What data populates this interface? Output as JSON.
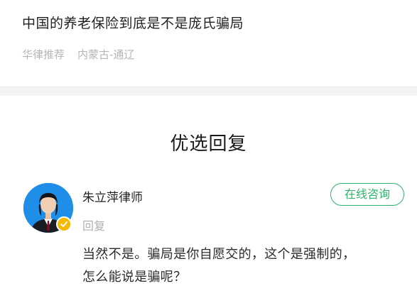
{
  "question": {
    "title": "中国的养老保险到底是不是庞氏骗局",
    "source": "华律推荐",
    "location": "内蒙古-通辽"
  },
  "section": {
    "title": "优选回复"
  },
  "reply": {
    "lawyer_name": "朱立萍律师",
    "reply_label": "回复",
    "consult_button": "在线咨询",
    "answer_line1": "当然不是。骗局是你自愿交的，这个是强制的，",
    "answer_line2": "怎么能说是骗呢？"
  },
  "colors": {
    "accent_green": "#2fb36b",
    "avatar_bg": "#1f8ee8",
    "verified_badge": "#f5b800"
  },
  "icons": [
    "verified-badge-icon"
  ]
}
